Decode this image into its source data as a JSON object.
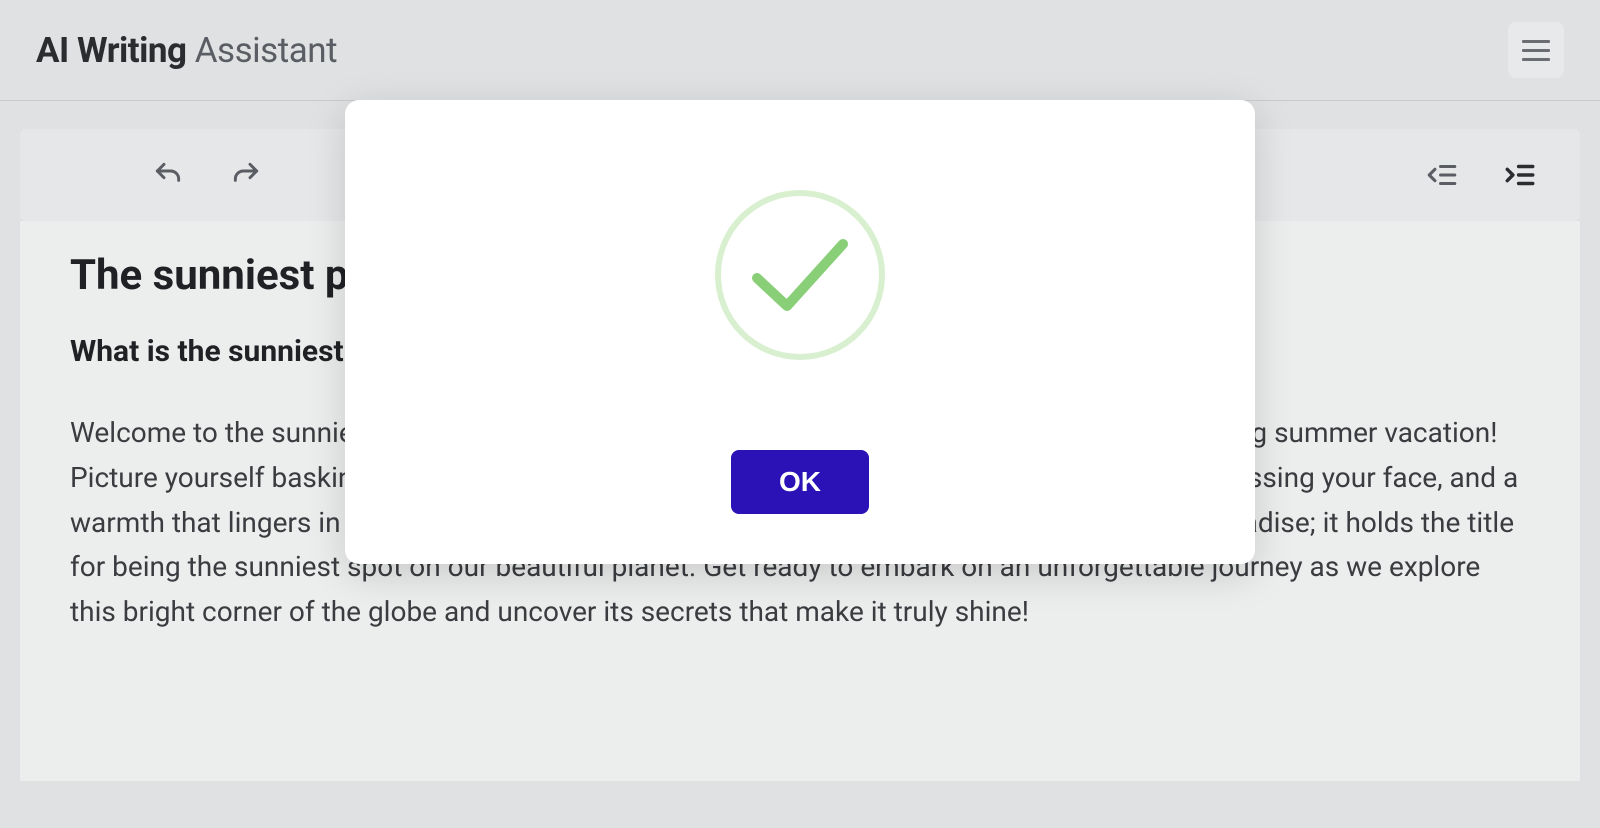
{
  "header": {
    "title_bold": "AI Writing",
    "title_light": " Assistant"
  },
  "document": {
    "title": "The sunniest place on earth",
    "subtitle": "What is the sunniest place on earth?",
    "body": "Welcome to the sunniest place on Earth, where rays of sunshine never take a break – introducing summer vacation! Picture yourself basking in golden light, feeling that gentle breeze of everlasting sun gently caressing your face, and a warmth that lingers in the air. This extraordinary destination is not just any ordinary tropical paradise; it holds the title for being the sunniest spot on our beautiful planet. Get ready to embark on an unforgettable journey as we explore this bright corner of the globe and uncover its secrets that make it truly shine!"
  },
  "dialog": {
    "ok_label": "OK"
  }
}
